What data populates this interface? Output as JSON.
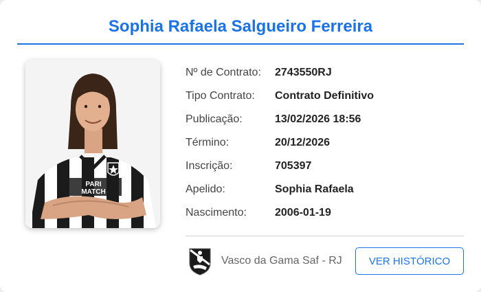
{
  "player": {
    "name": "Sophia Rafaela Salgueiro Ferreira",
    "photo_alt": "player-photo"
  },
  "details": [
    {
      "label": "Nº de Contrato:",
      "value": "2743550RJ"
    },
    {
      "label": "Tipo Contrato:",
      "value": "Contrato Definitivo"
    },
    {
      "label": "Publicação:",
      "value": "13/02/2026 18:56"
    },
    {
      "label": "Término:",
      "value": "20/12/2026"
    },
    {
      "label": "Inscrição:",
      "value": "705397"
    },
    {
      "label": "Apelido:",
      "value": "Sophia Rafaela"
    },
    {
      "label": "Nascimento:",
      "value": "2006-01-19"
    }
  ],
  "club": {
    "name": "Vasco da Gama Saf - RJ",
    "logo_icon": "club-crest-icon"
  },
  "actions": {
    "history_label": "VER HISTÓRICO"
  },
  "colors": {
    "accent": "#1a73e8",
    "background": "#ffffff"
  }
}
